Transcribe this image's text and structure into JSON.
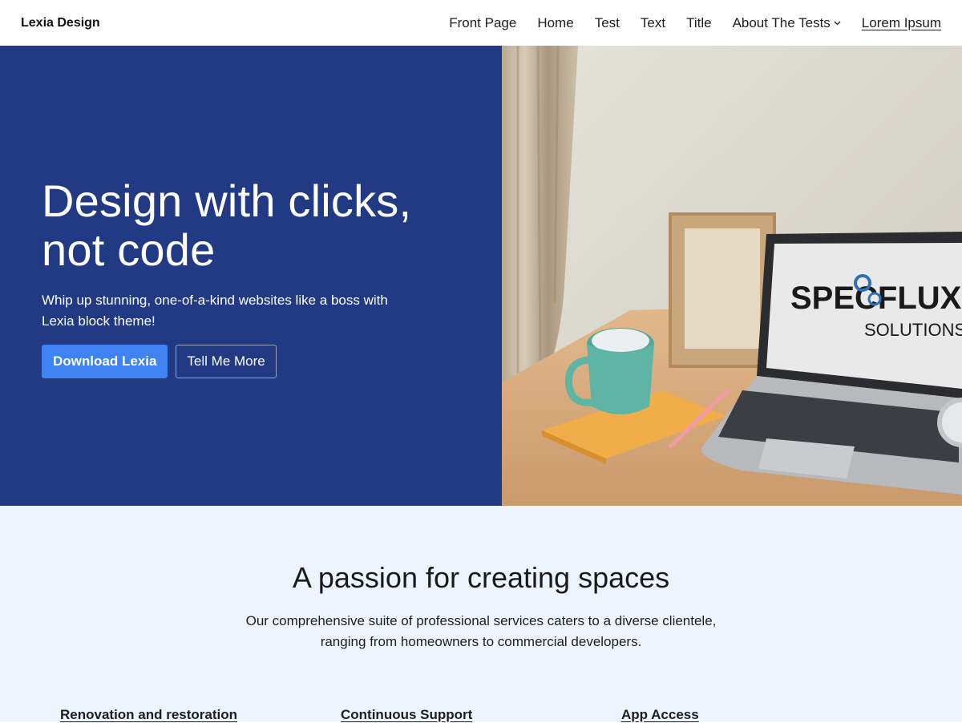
{
  "site": {
    "title": "Lexia Design"
  },
  "nav": {
    "items": [
      {
        "label": "Front Page"
      },
      {
        "label": "Home"
      },
      {
        "label": "Test"
      },
      {
        "label": "Text"
      },
      {
        "label": "Title"
      },
      {
        "label": "About The Tests",
        "icon": "chevron-down-icon"
      },
      {
        "label": "Lorem Ipsum"
      }
    ]
  },
  "hero": {
    "title_line1": "Design with clicks,",
    "title_line2": "not code",
    "subtitle": "Whip up stunning, one-of-a-kind websites like a boss with Lexia block theme!",
    "primary_button": "Download Lexia",
    "secondary_button": "Tell Me More",
    "image": {
      "laptop_brand_line1": "SPECFLUX",
      "laptop_brand_line2": "SOLUTIONS"
    },
    "colors": {
      "background": "#223a84",
      "primary_button": "#3f83f2"
    }
  },
  "services": {
    "title": "A passion for creating spaces",
    "description": "Our comprehensive suite of professional services caters to a diverse clientele, ranging from homeowners to commercial developers.",
    "features": [
      {
        "label": "Renovation and restoration"
      },
      {
        "label": "Continuous Support"
      },
      {
        "label": "App Access"
      }
    ],
    "colors": {
      "background": "#eef4fd"
    }
  }
}
